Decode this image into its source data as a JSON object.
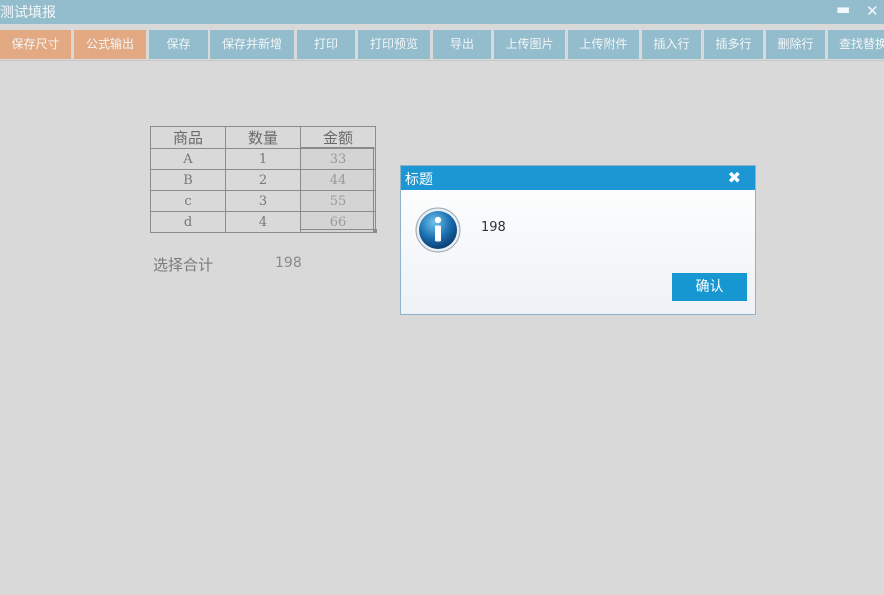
{
  "window": {
    "title": "测试填报",
    "minimize_glyph": "▬",
    "close_glyph": "✕"
  },
  "toolbar": {
    "buttons": [
      {
        "label": "保存尺寸",
        "style": "orange"
      },
      {
        "label": "公式输出",
        "style": "orange"
      },
      {
        "label": "保存",
        "style": "blue"
      },
      {
        "label": "保存并新增",
        "style": "blue"
      },
      {
        "label": "打印",
        "style": "blue"
      },
      {
        "label": "打印预览",
        "style": "blue"
      },
      {
        "label": "导出",
        "style": "blue"
      },
      {
        "label": "上传图片",
        "style": "blue"
      },
      {
        "label": "上传附件",
        "style": "blue"
      },
      {
        "label": "插入行",
        "style": "blue"
      },
      {
        "label": "插多行",
        "style": "blue"
      },
      {
        "label": "删除行",
        "style": "blue"
      },
      {
        "label": "查找替换",
        "style": "blue"
      }
    ]
  },
  "sheet": {
    "headers": [
      "商品",
      "数量",
      "金额"
    ],
    "rows": [
      [
        "A",
        "1",
        "33"
      ],
      [
        "B",
        "2",
        "44"
      ],
      [
        "c",
        "3",
        "55"
      ],
      [
        "d",
        "4",
        "66"
      ]
    ],
    "sum_label": "选择合计",
    "sum_value": "198"
  },
  "dialog": {
    "title": "标题",
    "close_glyph": "✖",
    "message": "198",
    "icon": "info-icon",
    "ok_label": "确认"
  },
  "colors": {
    "titlebar": "#93bccc",
    "toolbar_blue": "#93bccc",
    "toolbar_orange": "#e2a982",
    "dialog_header": "#1d97d4",
    "ok_button": "#1797d2",
    "background": "#d9d9d9"
  }
}
